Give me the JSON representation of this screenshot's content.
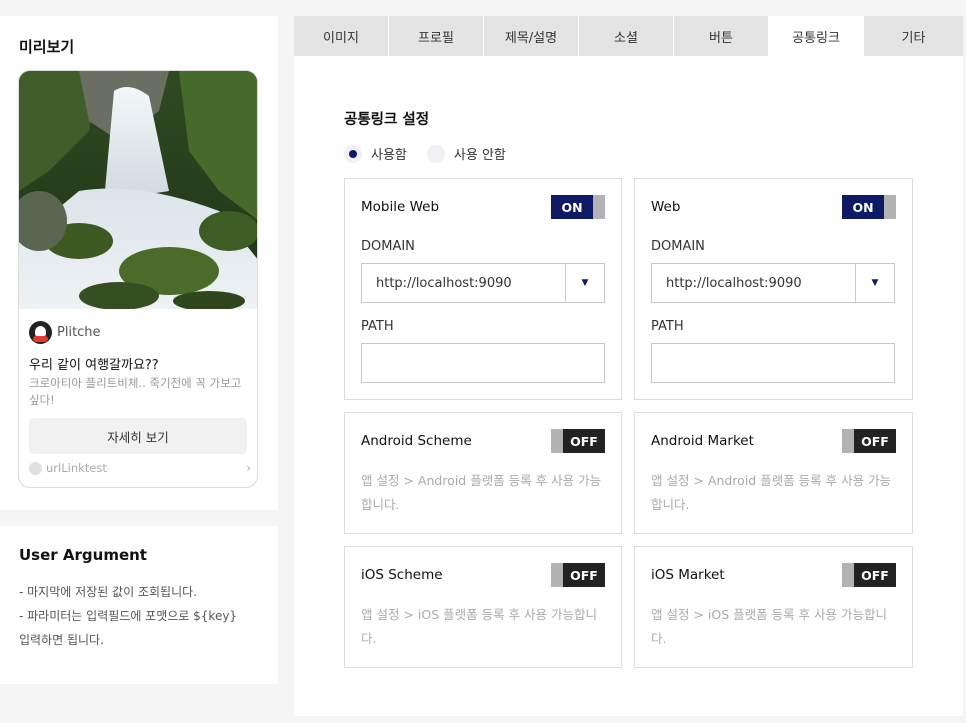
{
  "preview": {
    "title": "미리보기",
    "card": {
      "profile_name": "Plitche",
      "title": "우리 같이 여행갈까요??",
      "description": "크로아티아 플리트비체.. 죽기전에 꼭 가보고싶다!",
      "button_label": "자세히 보기",
      "link_label": "urlLinktest"
    }
  },
  "user_argument": {
    "title": "User Argument",
    "lines": [
      "- 마지막에 저장된 값이 조회됩니다.",
      "- 파라미터는 입력필드에 포맷으로 ${key}",
      "입력하면 됩니다."
    ]
  },
  "tabs": [
    {
      "label": "이미지"
    },
    {
      "label": "프로필"
    },
    {
      "label": "제목/설명"
    },
    {
      "label": "소셜"
    },
    {
      "label": "버튼"
    },
    {
      "label": "공통링크"
    },
    {
      "label": "기타"
    }
  ],
  "active_tab": "공통링크",
  "settings": {
    "title": "공통링크 설정",
    "radio_use": "사용함",
    "radio_not_use": "사용 안함",
    "selected": "사용함"
  },
  "boxes": {
    "mobile_web": {
      "title": "Mobile Web",
      "toggle": "ON",
      "domain_label": "DOMAIN",
      "domain_value": "http://localhost:9090",
      "path_label": "PATH",
      "path_value": ""
    },
    "web": {
      "title": "Web",
      "toggle": "ON",
      "domain_label": "DOMAIN",
      "domain_value": "http://localhost:9090",
      "path_label": "PATH",
      "path_value": ""
    },
    "android_scheme": {
      "title": "Android Scheme",
      "toggle": "OFF",
      "note": "앱 설정 > Android 플랫폼 등록 후 사용 가능합니다."
    },
    "android_market": {
      "title": "Android Market",
      "toggle": "OFF",
      "note": "앱 설정 > Android 플랫폼 등록 후 사용 가능합니다."
    },
    "ios_scheme": {
      "title": "iOS Scheme",
      "toggle": "OFF",
      "note": "앱 설정 > iOS 플랫폼 등록 후 사용 가능합니다."
    },
    "ios_market": {
      "title": "iOS Market",
      "toggle": "OFF",
      "note": "앱 설정 > iOS 플랫폼 등록 후 사용 가능합니다."
    }
  },
  "colors": {
    "accent": "#0e1a66",
    "toggle_off": "#222222",
    "toggle_knob": "#b3b3b3",
    "tab_bg": "#e4e4e4"
  }
}
